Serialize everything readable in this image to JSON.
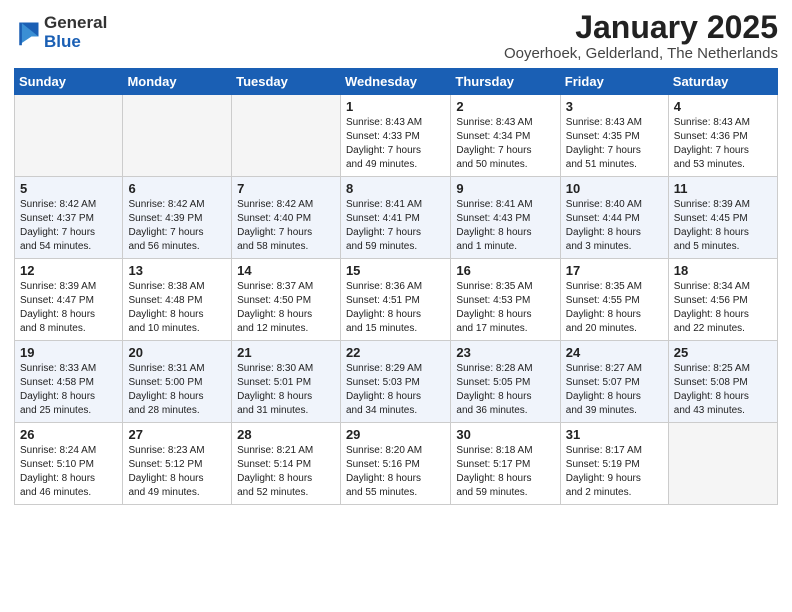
{
  "logo": {
    "general": "General",
    "blue": "Blue"
  },
  "header": {
    "month": "January 2025",
    "location": "Ooyerhoek, Gelderland, The Netherlands"
  },
  "weekdays": [
    "Sunday",
    "Monday",
    "Tuesday",
    "Wednesday",
    "Thursday",
    "Friday",
    "Saturday"
  ],
  "weeks": [
    [
      {
        "day": "",
        "info": ""
      },
      {
        "day": "",
        "info": ""
      },
      {
        "day": "",
        "info": ""
      },
      {
        "day": "1",
        "info": "Sunrise: 8:43 AM\nSunset: 4:33 PM\nDaylight: 7 hours\nand 49 minutes."
      },
      {
        "day": "2",
        "info": "Sunrise: 8:43 AM\nSunset: 4:34 PM\nDaylight: 7 hours\nand 50 minutes."
      },
      {
        "day": "3",
        "info": "Sunrise: 8:43 AM\nSunset: 4:35 PM\nDaylight: 7 hours\nand 51 minutes."
      },
      {
        "day": "4",
        "info": "Sunrise: 8:43 AM\nSunset: 4:36 PM\nDaylight: 7 hours\nand 53 minutes."
      }
    ],
    [
      {
        "day": "5",
        "info": "Sunrise: 8:42 AM\nSunset: 4:37 PM\nDaylight: 7 hours\nand 54 minutes."
      },
      {
        "day": "6",
        "info": "Sunrise: 8:42 AM\nSunset: 4:39 PM\nDaylight: 7 hours\nand 56 minutes."
      },
      {
        "day": "7",
        "info": "Sunrise: 8:42 AM\nSunset: 4:40 PM\nDaylight: 7 hours\nand 58 minutes."
      },
      {
        "day": "8",
        "info": "Sunrise: 8:41 AM\nSunset: 4:41 PM\nDaylight: 7 hours\nand 59 minutes."
      },
      {
        "day": "9",
        "info": "Sunrise: 8:41 AM\nSunset: 4:43 PM\nDaylight: 8 hours\nand 1 minute."
      },
      {
        "day": "10",
        "info": "Sunrise: 8:40 AM\nSunset: 4:44 PM\nDaylight: 8 hours\nand 3 minutes."
      },
      {
        "day": "11",
        "info": "Sunrise: 8:39 AM\nSunset: 4:45 PM\nDaylight: 8 hours\nand 5 minutes."
      }
    ],
    [
      {
        "day": "12",
        "info": "Sunrise: 8:39 AM\nSunset: 4:47 PM\nDaylight: 8 hours\nand 8 minutes."
      },
      {
        "day": "13",
        "info": "Sunrise: 8:38 AM\nSunset: 4:48 PM\nDaylight: 8 hours\nand 10 minutes."
      },
      {
        "day": "14",
        "info": "Sunrise: 8:37 AM\nSunset: 4:50 PM\nDaylight: 8 hours\nand 12 minutes."
      },
      {
        "day": "15",
        "info": "Sunrise: 8:36 AM\nSunset: 4:51 PM\nDaylight: 8 hours\nand 15 minutes."
      },
      {
        "day": "16",
        "info": "Sunrise: 8:35 AM\nSunset: 4:53 PM\nDaylight: 8 hours\nand 17 minutes."
      },
      {
        "day": "17",
        "info": "Sunrise: 8:35 AM\nSunset: 4:55 PM\nDaylight: 8 hours\nand 20 minutes."
      },
      {
        "day": "18",
        "info": "Sunrise: 8:34 AM\nSunset: 4:56 PM\nDaylight: 8 hours\nand 22 minutes."
      }
    ],
    [
      {
        "day": "19",
        "info": "Sunrise: 8:33 AM\nSunset: 4:58 PM\nDaylight: 8 hours\nand 25 minutes."
      },
      {
        "day": "20",
        "info": "Sunrise: 8:31 AM\nSunset: 5:00 PM\nDaylight: 8 hours\nand 28 minutes."
      },
      {
        "day": "21",
        "info": "Sunrise: 8:30 AM\nSunset: 5:01 PM\nDaylight: 8 hours\nand 31 minutes."
      },
      {
        "day": "22",
        "info": "Sunrise: 8:29 AM\nSunset: 5:03 PM\nDaylight: 8 hours\nand 34 minutes."
      },
      {
        "day": "23",
        "info": "Sunrise: 8:28 AM\nSunset: 5:05 PM\nDaylight: 8 hours\nand 36 minutes."
      },
      {
        "day": "24",
        "info": "Sunrise: 8:27 AM\nSunset: 5:07 PM\nDaylight: 8 hours\nand 39 minutes."
      },
      {
        "day": "25",
        "info": "Sunrise: 8:25 AM\nSunset: 5:08 PM\nDaylight: 8 hours\nand 43 minutes."
      }
    ],
    [
      {
        "day": "26",
        "info": "Sunrise: 8:24 AM\nSunset: 5:10 PM\nDaylight: 8 hours\nand 46 minutes."
      },
      {
        "day": "27",
        "info": "Sunrise: 8:23 AM\nSunset: 5:12 PM\nDaylight: 8 hours\nand 49 minutes."
      },
      {
        "day": "28",
        "info": "Sunrise: 8:21 AM\nSunset: 5:14 PM\nDaylight: 8 hours\nand 52 minutes."
      },
      {
        "day": "29",
        "info": "Sunrise: 8:20 AM\nSunset: 5:16 PM\nDaylight: 8 hours\nand 55 minutes."
      },
      {
        "day": "30",
        "info": "Sunrise: 8:18 AM\nSunset: 5:17 PM\nDaylight: 8 hours\nand 59 minutes."
      },
      {
        "day": "31",
        "info": "Sunrise: 8:17 AM\nSunset: 5:19 PM\nDaylight: 9 hours\nand 2 minutes."
      },
      {
        "day": "",
        "info": ""
      }
    ]
  ]
}
